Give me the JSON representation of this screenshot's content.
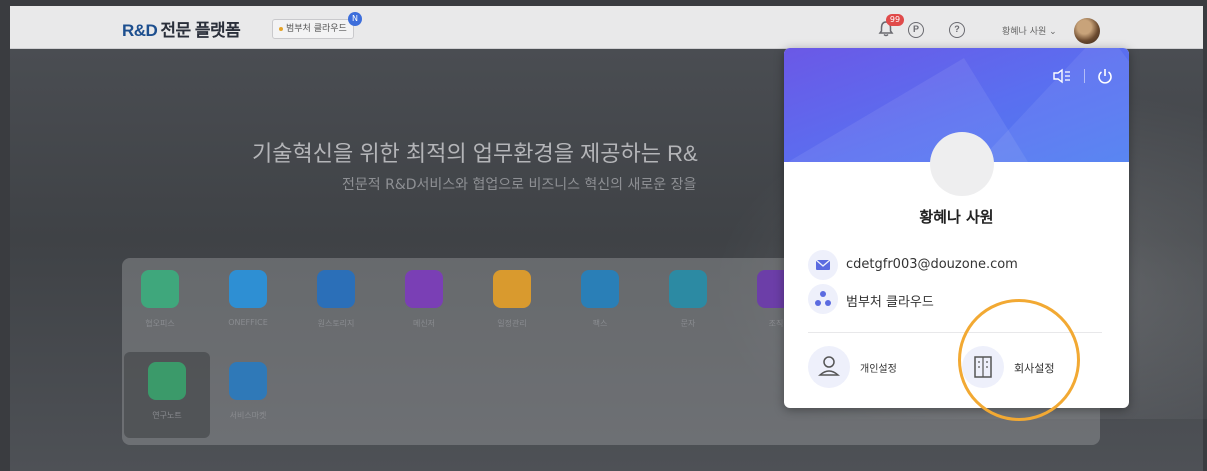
{
  "topbar": {
    "brand_latin": "R&D",
    "brand_korean": "전문 플랫폼",
    "company_badge": "범부처 클라우드",
    "company_badge_count": "N",
    "notification_count": "99",
    "point_icon_letter": "P",
    "help_icon_letter": "?",
    "user_label": "황혜나 사원"
  },
  "hero": {
    "title": "기술혁신을 위한 최적의 업무환경을 제공하는 R&",
    "subtitle": "전문적 R&D서비스와 협업으로 비즈니스 혁신의 새로운 장을"
  },
  "apps": [
    {
      "label": "협오피스",
      "color": "#3fa77c"
    },
    {
      "label": "ONEFFICE",
      "color": "#2e8fd3"
    },
    {
      "label": "원스토리지",
      "color": "#2b6fb8"
    },
    {
      "label": "메신저",
      "color": "#7a3fb5"
    },
    {
      "label": "일정관리",
      "color": "#d99a2e"
    },
    {
      "label": "팩스",
      "color": "#2a7fb7"
    },
    {
      "label": "문자",
      "color": "#2c8aa3"
    },
    {
      "label": "조직",
      "color": "#6c3ea8"
    },
    {
      "label": "연구노트",
      "color": "#3b9a6a"
    },
    {
      "label": "서비스마켓",
      "color": "#2f79b8"
    }
  ],
  "popup": {
    "name": "황혜나 사원",
    "email": "cdetgfr003@douzone.com",
    "organization": "범부처 클라우드",
    "personal_settings": "개인설정",
    "company_settings": "회사설정",
    "header_color": "#6060ea",
    "highlight_ring_color": "#f2a933"
  }
}
